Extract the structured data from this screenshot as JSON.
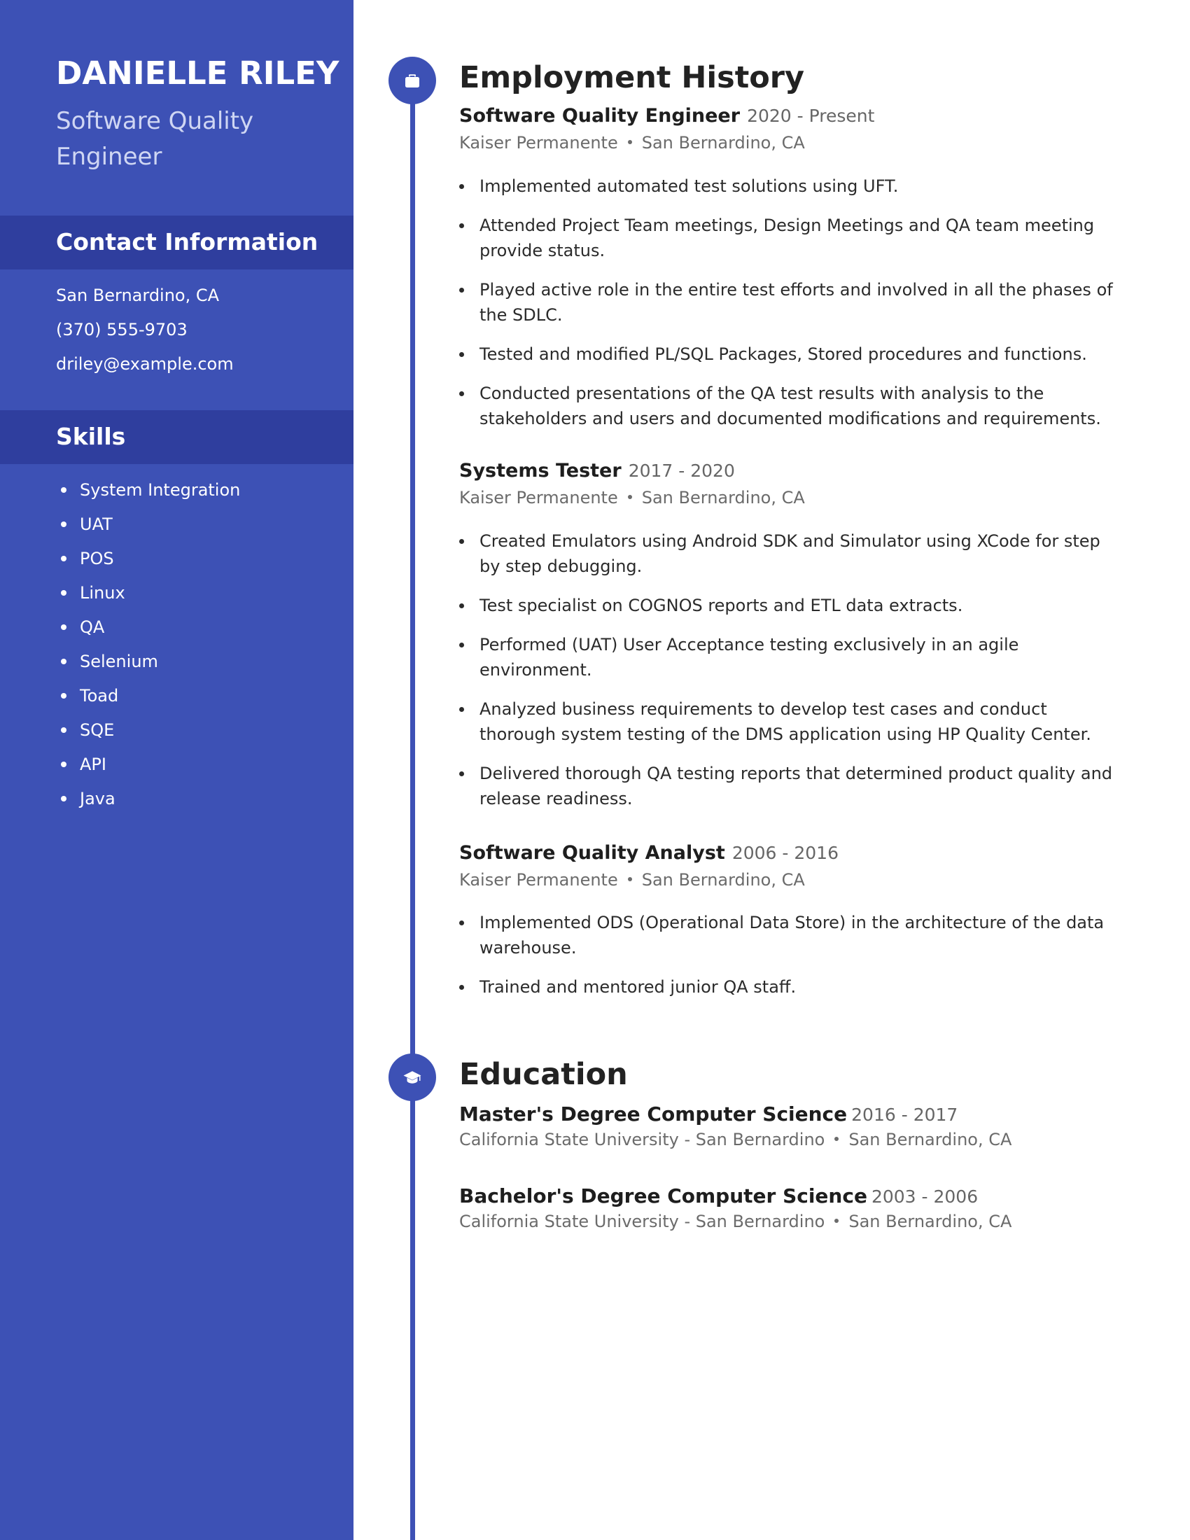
{
  "profile": {
    "name": "DANIELLE RILEY",
    "title": "Software Quality Engineer"
  },
  "contact": {
    "heading": "Contact Information",
    "location": "San Bernardino, CA",
    "phone": "(370) 555-9703",
    "email": "driley@example.com"
  },
  "skills": {
    "heading": "Skills",
    "items": [
      "System Integration",
      "UAT",
      "POS",
      "Linux",
      "QA",
      "Selenium",
      "Toad",
      "SQE",
      "API",
      "Java"
    ]
  },
  "employment": {
    "heading": "Employment History",
    "icon": "briefcase-icon",
    "jobs": [
      {
        "title": "Software Quality Engineer",
        "dates": "2020 - Present",
        "company": "Kaiser Permanente",
        "location": "San Bernardino, CA",
        "bullets": [
          "Implemented automated test solutions using UFT.",
          "Attended Project Team meetings, Design Meetings and QA team meeting provide status.",
          "Played active role in the entire test efforts and involved in all the phases of the SDLC.",
          "Tested and modified PL/SQL Packages, Stored procedures and functions.",
          "Conducted presentations of the QA test results with analysis to the stakeholders and users and documented modifications and requirements."
        ]
      },
      {
        "title": "Systems Tester",
        "dates": "2017 - 2020",
        "company": "Kaiser Permanente",
        "location": "San Bernardino, CA",
        "bullets": [
          "Created Emulators using Android SDK and Simulator using XCode for step by step debugging.",
          "Test specialist on COGNOS reports and ETL data extracts.",
          "Performed (UAT) User Acceptance testing exclusively in an agile environment.",
          "Analyzed business requirements to develop test cases and conduct thorough system testing of the DMS application using HP Quality Center.",
          "Delivered thorough QA testing reports that determined product quality and release readiness."
        ]
      },
      {
        "title": "Software Quality Analyst",
        "dates": "2006 - 2016",
        "company": "Kaiser Permanente",
        "location": "San Bernardino, CA",
        "bullets": [
          "Implemented ODS (Operational Data Store) in the architecture of the data warehouse.",
          "Trained and mentored junior QA staff."
        ]
      }
    ]
  },
  "education": {
    "heading": "Education",
    "icon": "graduation-cap-icon",
    "degrees": [
      {
        "title": "Master's Degree Computer Science",
        "dates": "2016 - 2017",
        "school": "California State University - San Bernardino",
        "location": "San Bernardino, CA"
      },
      {
        "title": "Bachelor's Degree Computer Science",
        "dates": "2003 - 2006",
        "school": "California State University - San Bernardino",
        "location": "San Bernardino, CA"
      }
    ]
  },
  "colors": {
    "sidebar": "#3d51b5",
    "band": "#2f3e9e",
    "accent": "#3d51b5"
  }
}
